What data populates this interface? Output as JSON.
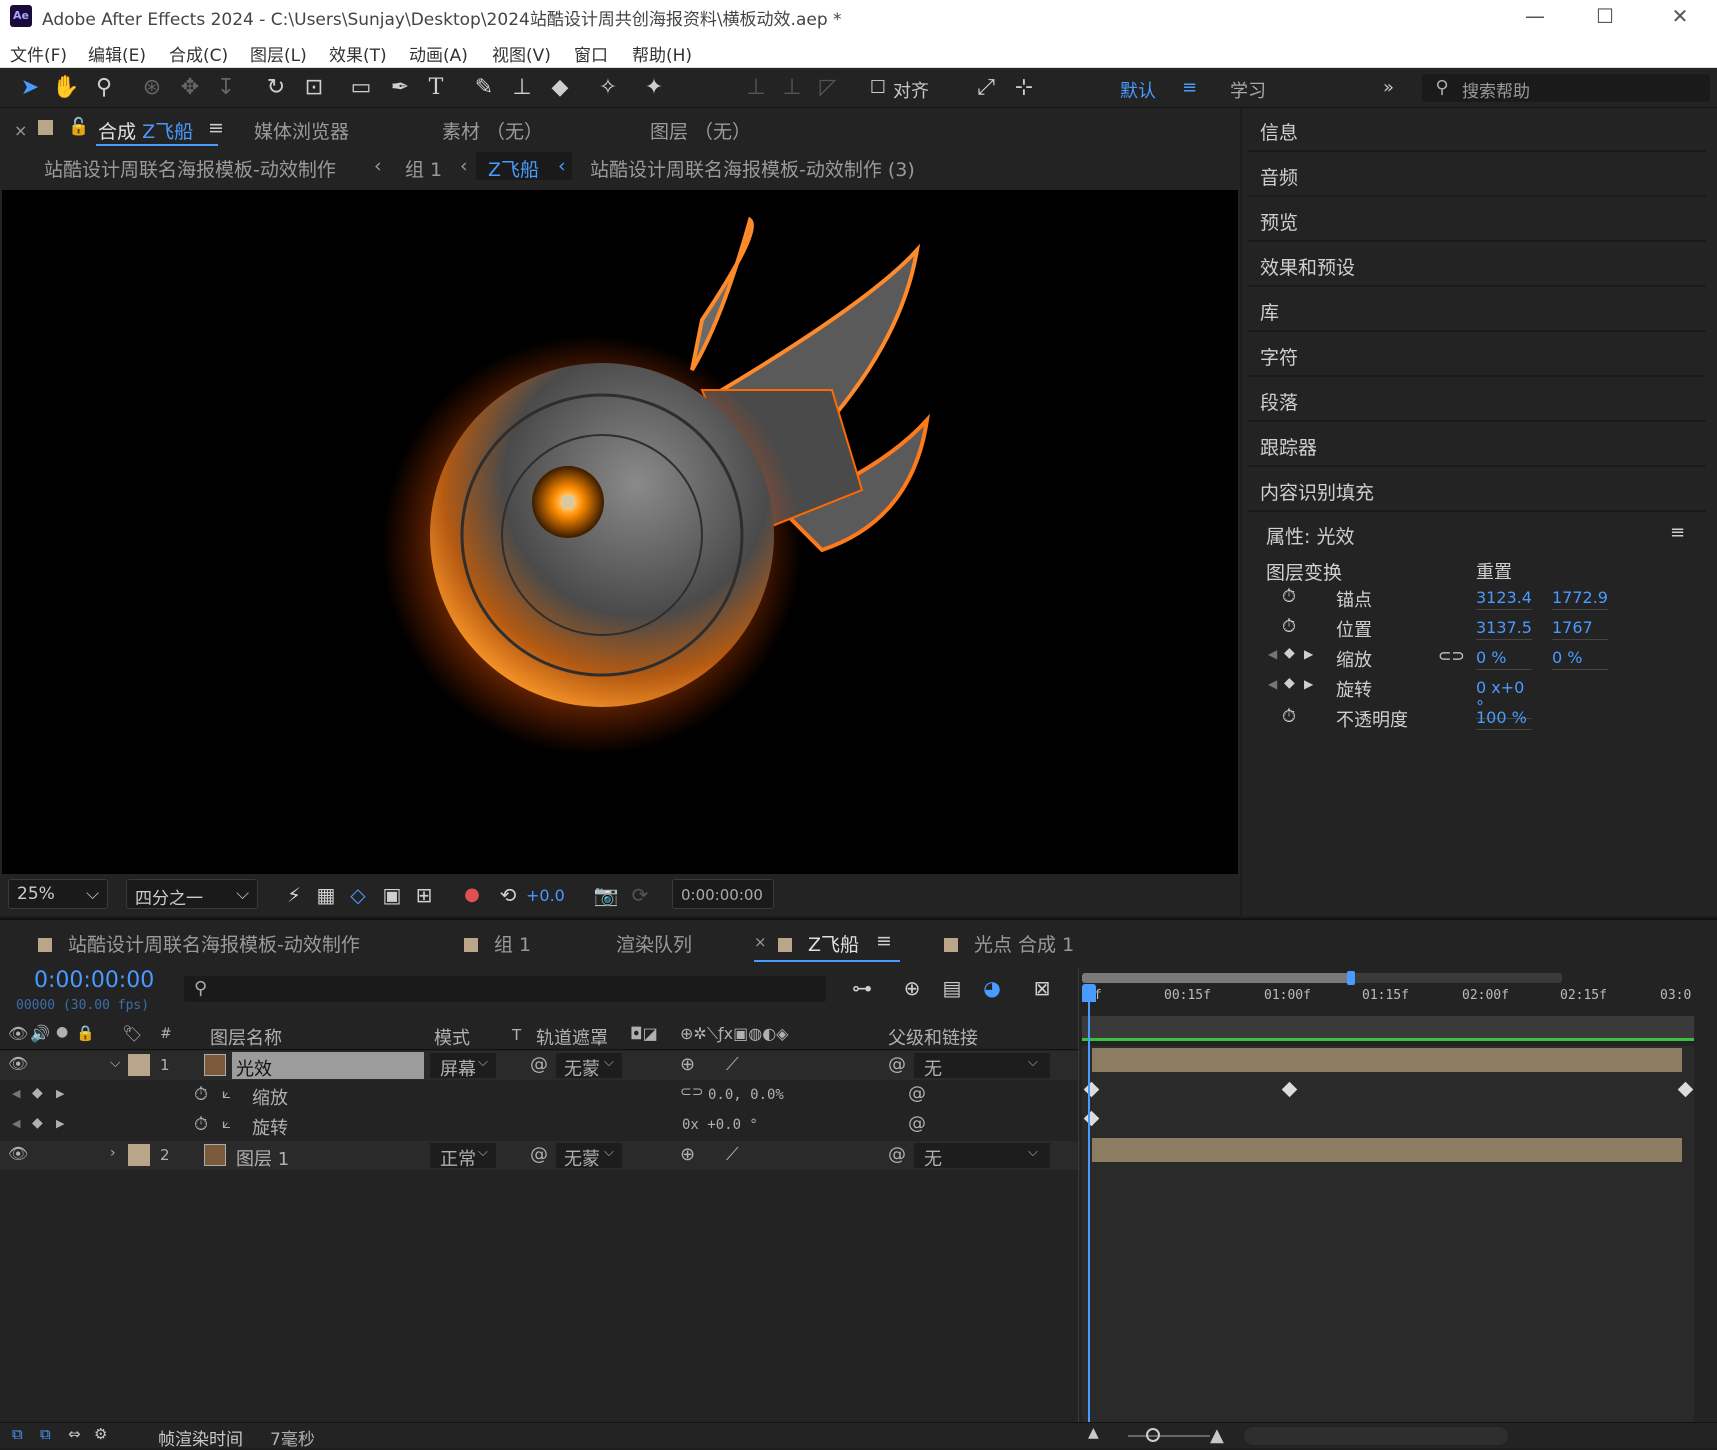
{
  "window": {
    "title": "Adobe After Effects 2024 - C:\\Users\\Sunjay\\Desktop\\2024站酷设计周共创海报资料\\横板动效.aep *",
    "logo": "Ae",
    "minimize": "—",
    "maximize": "☐",
    "close": "✕"
  },
  "menu": [
    "文件(F)",
    "编辑(E)",
    "合成(C)",
    "图层(L)",
    "效果(T)",
    "动画(A)",
    "视图(V)",
    "窗口",
    "帮助(H)"
  ],
  "toolbar": {
    "align_label": "对齐",
    "workspace_default": "默认",
    "workspace_learn": "学习",
    "search_placeholder": "搜索帮助",
    "more": "»"
  },
  "comp_panel": {
    "close": "×",
    "tab_prefix": "合成",
    "tab_name": "Z飞船",
    "tab_menu": "≡",
    "other_tabs": [
      "媒体浏览器",
      "素材 （无）",
      "图层 （无）"
    ],
    "breadcrumbs": [
      "站酷设计周联名海报模板-动效制作",
      "组 1",
      "Z飞船",
      "站酷设计周联名海报模板-动效制作 (3)"
    ],
    "zoom": "25%",
    "resolution": "四分之一",
    "exposure": "+0.0",
    "timecode": "0:00:00:00"
  },
  "right_panel": {
    "items": [
      "信息",
      "音频",
      "预览",
      "效果和预设",
      "库",
      "字符",
      "段落",
      "跟踪器",
      "内容识别填充"
    ],
    "properties_title": "属性: 光效",
    "menu": "≡",
    "transform_label": "图层变换",
    "reset": "重置",
    "props": [
      {
        "label": "锚点",
        "v1": "3123.4",
        "v2": "1772.9"
      },
      {
        "label": "位置",
        "v1": "3137.5",
        "v2": "1767"
      },
      {
        "label": "缩放",
        "v1": "0 %",
        "v2": "0 %"
      },
      {
        "label": "旋转",
        "v1": "0 x+0 °",
        "v2": ""
      },
      {
        "label": "不透明度",
        "v1": "100 %",
        "v2": ""
      }
    ]
  },
  "timeline": {
    "tabs": [
      "站酷设计周联名海报模板-动效制作",
      "组 1",
      "渲染队列",
      "Z飞船",
      "光点 合成 1"
    ],
    "tab_close": "×",
    "tab_menu": "≡",
    "timecode": "0:00:00:00",
    "frame_info": "00000 (30.00 fps)",
    "ruler": [
      "0f",
      "00:15f",
      "01:00f",
      "01:15f",
      "02:00f",
      "02:15f",
      "03:0"
    ],
    "headers": {
      "num": "#",
      "name": "图层名称",
      "mode": "模式",
      "t": "T",
      "matte": "轨道遮罩",
      "parent": "父级和链接"
    },
    "layers": [
      {
        "num": "1",
        "name": "光效",
        "mode": "屏幕",
        "matte": "无蒙",
        "parent": "无"
      },
      {
        "num": "2",
        "name": "图层 1",
        "mode": "正常",
        "matte": "无蒙",
        "parent": "无"
      }
    ],
    "sub_props": [
      {
        "label": "缩放",
        "value": "0.0, 0.0%"
      },
      {
        "label": "旋转",
        "value": "0x +0.0 °"
      }
    ],
    "work_area_progress": 0.56,
    "status": {
      "label": "帧渲染时间",
      "value": "7毫秒"
    }
  },
  "colors": {
    "accent": "#4a9bff",
    "layer_label": "#b9a68a",
    "bar_green": "#3fbf3f"
  }
}
